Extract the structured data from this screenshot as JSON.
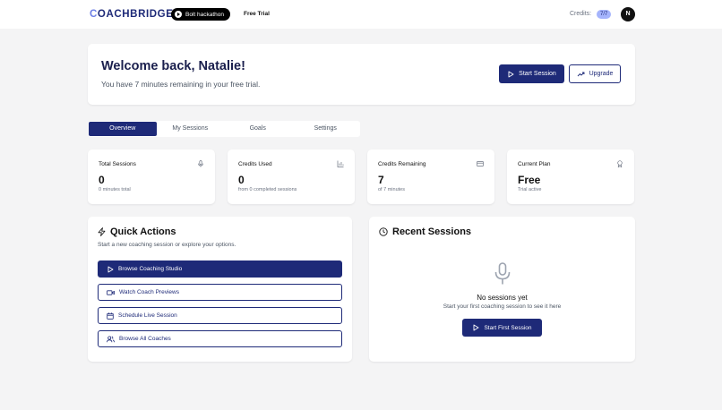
{
  "header": {
    "logo_prefix": "C",
    "logo_rest": "OACHBRIDGE",
    "bolt_label": "Bolt hackathon",
    "free_trial": "Free Trial",
    "credits_label": "Credits:",
    "credits_value": "7/7",
    "avatar_initial": "N"
  },
  "welcome": {
    "title": "Welcome back, Natalie!",
    "subtitle": "You have 7 minutes remaining in your free trial.",
    "start_session": "Start Session",
    "upgrade": "Upgrade"
  },
  "tabs": [
    {
      "label": "Overview",
      "active": true
    },
    {
      "label": "My Sessions",
      "active": false
    },
    {
      "label": "Goals",
      "active": false
    },
    {
      "label": "Settings",
      "active": false
    }
  ],
  "stats": [
    {
      "label": "Total Sessions",
      "value": "0",
      "sub": "0 minutes total",
      "icon": "mic-icon"
    },
    {
      "label": "Credits Used",
      "value": "0",
      "sub": "from 0 completed sessions",
      "icon": "bar-chart-icon"
    },
    {
      "label": "Credits Remaining",
      "value": "7",
      "sub": "of 7 minutes",
      "icon": "credit-card-icon"
    },
    {
      "label": "Current Plan",
      "value": "Free",
      "sub": "Trial active",
      "icon": "award-icon"
    }
  ],
  "quick_actions": {
    "title": "Quick Actions",
    "subtitle": "Start a new coaching session or explore your options.",
    "buttons": [
      {
        "label": "Browse Coaching Studio",
        "icon": "play-icon"
      },
      {
        "label": "Watch Coach Previews",
        "icon": "video-icon"
      },
      {
        "label": "Schedule Live Session",
        "icon": "calendar-icon"
      },
      {
        "label": "Browse All Coaches",
        "icon": "users-icon"
      }
    ]
  },
  "recent_sessions": {
    "title": "Recent Sessions",
    "empty_title": "No sessions yet",
    "empty_subtitle": "Start your first coaching session to see it here",
    "button": "Start First Session"
  },
  "colors": {
    "primary": "#1e2a78",
    "accent": "#a5b4fc",
    "background": "#f4f4f5"
  }
}
